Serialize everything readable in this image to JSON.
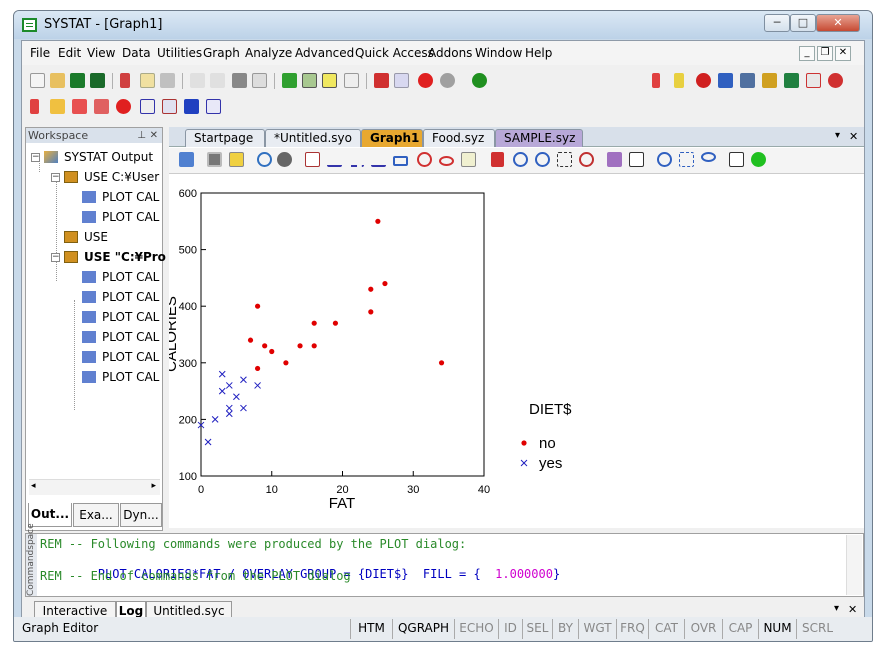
{
  "window": {
    "title": "SYSTAT - [Graph1]",
    "minimize": "─",
    "maximize": "□",
    "close": "✕"
  },
  "menu": [
    "File",
    "Edit",
    "View",
    "Data",
    "Utilities",
    "Graph",
    "Analyze",
    "Advanced",
    "Quick Access",
    "Addons",
    "Window",
    "Help"
  ],
  "mdi": {
    "min": "_",
    "restore": "❐",
    "close": "✕"
  },
  "workspace": {
    "title": "Workspace",
    "pin": "⊥",
    "close": "✕",
    "nodes": [
      {
        "label": "SYSTAT Output"
      },
      {
        "label": "USE C:¥User"
      },
      {
        "label": "PLOT CAL"
      },
      {
        "label": "PLOT CAL"
      },
      {
        "label": "USE"
      },
      {
        "label": "USE \"C:¥Pro"
      },
      {
        "label": "PLOT CAL"
      },
      {
        "label": "PLOT CAL"
      },
      {
        "label": "PLOT CAL"
      },
      {
        "label": "PLOT CAL"
      },
      {
        "label": "PLOT CAL"
      },
      {
        "label": "PLOT CAL"
      }
    ],
    "tabs": [
      "Out...",
      "Exa...",
      "Dyn..."
    ]
  },
  "doc_tabs": [
    "Startpage",
    "*Untitled.syo",
    "Graph1",
    "Food.syz",
    "SAMPLE.syz"
  ],
  "doc_tab_controls": {
    "menu": "▾",
    "close": "✕"
  },
  "chart_data": {
    "type": "scatter",
    "xlabel": "FAT",
    "ylabel": "CALORIES",
    "xlim": [
      0,
      40
    ],
    "ylim": [
      100,
      600
    ],
    "xticks": [
      "0",
      "10",
      "20",
      "30",
      "40"
    ],
    "yticks": [
      "100",
      "200",
      "300",
      "400",
      "500",
      "600"
    ],
    "legend": {
      "title": "DIET$",
      "placement": "right"
    },
    "series": [
      {
        "name": "no",
        "marker": "dot",
        "color": "#e00000",
        "points": [
          [
            7,
            340
          ],
          [
            8,
            290
          ],
          [
            8,
            400
          ],
          [
            9,
            330
          ],
          [
            10,
            320
          ],
          [
            12,
            300
          ],
          [
            14,
            330
          ],
          [
            16,
            370
          ],
          [
            16,
            330
          ],
          [
            19,
            370
          ],
          [
            24,
            430
          ],
          [
            24,
            390
          ],
          [
            25,
            550
          ],
          [
            26,
            440
          ],
          [
            34,
            300
          ]
        ]
      },
      {
        "name": "yes",
        "marker": "x",
        "color": "#2020c0",
        "points": [
          [
            0,
            190
          ],
          [
            1,
            160
          ],
          [
            2,
            200
          ],
          [
            3,
            250
          ],
          [
            3,
            280
          ],
          [
            4,
            210
          ],
          [
            4,
            220
          ],
          [
            4,
            260
          ],
          [
            5,
            240
          ],
          [
            6,
            220
          ],
          [
            6,
            270
          ],
          [
            8,
            260
          ]
        ]
      }
    ]
  },
  "commands": {
    "side_label": "Commandspace",
    "line1": "REM -- Following commands were produced by the PLOT dialog:",
    "line2_cmd": "PLOT CALORIES*FAT / OVERLAY GROUP = {DIET$}  FILL = {",
    "line2_val": "1.000000",
    "line2_end": "}",
    "line3": "REM -- End of commands from the PLOT dialog"
  },
  "bottom_tabs": [
    "Interactive",
    "Log",
    "Untitled.syc"
  ],
  "status": {
    "text": "Graph Editor",
    "panes": [
      "HTM",
      "QGRAPH",
      "ECHO",
      "ID",
      "SEL",
      "BY",
      "WGT",
      "FRQ",
      "CAT",
      "OVR",
      "CAP",
      "NUM",
      "SCRL"
    ],
    "active": [
      "HTM",
      "QGRAPH",
      "NUM"
    ]
  },
  "colors": {
    "accent": "#e8a830",
    "title_bg": "#c9daea",
    "no": "#e00000",
    "yes": "#2020c0",
    "cmd_green": "#2a8a2a",
    "cmd_blue": "#0000c0",
    "cmd_magenta": "#d000d0"
  }
}
